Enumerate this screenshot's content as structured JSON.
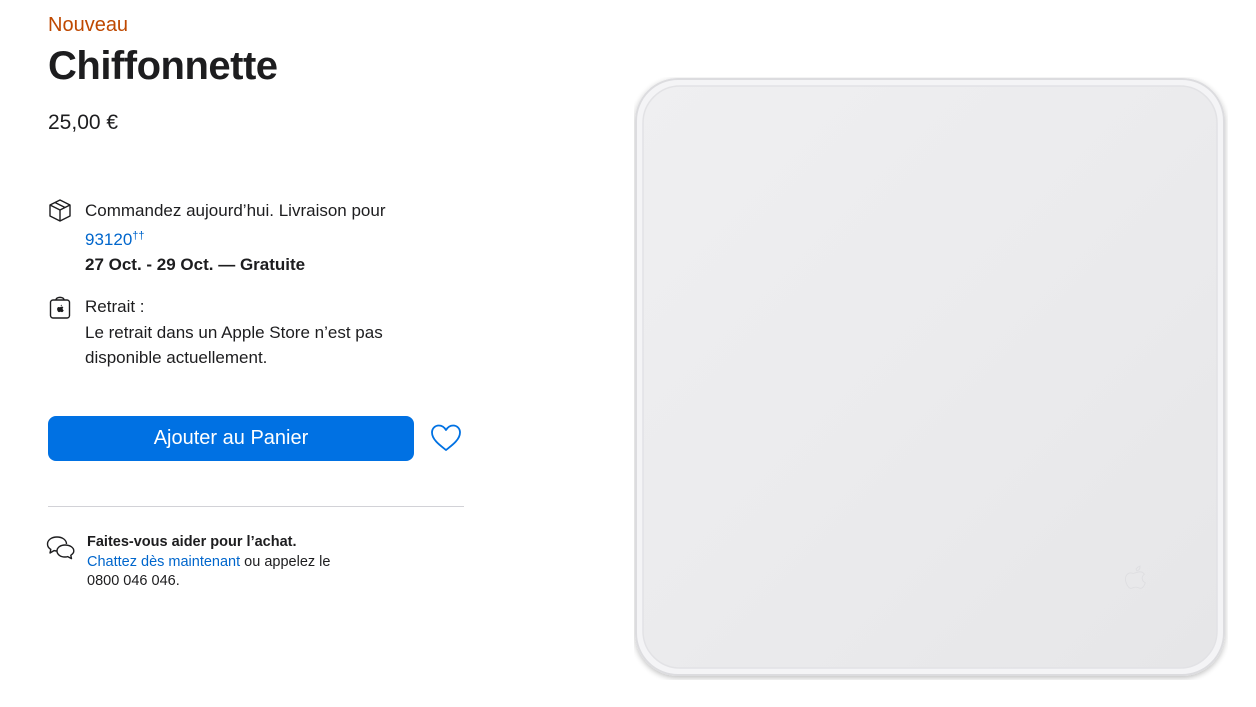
{
  "product": {
    "badge": "Nouveau",
    "name": "Chiffonnette",
    "price": "25,00 €"
  },
  "delivery": {
    "icon": "package-icon",
    "line1": "Commandez aujourd’hui. Livraison pour",
    "zip": "93120",
    "zip_marker": "††",
    "dates": "27 Oct. - 29 Oct. — Gratuite"
  },
  "pickup": {
    "icon": "apple-store-bag-icon",
    "label": "Retrait :",
    "line1": "Le retrait dans un Apple Store n’est pas",
    "line2": "disponible actuellement."
  },
  "actions": {
    "add_to_bag": "Ajouter au Panier",
    "favorite_icon": "heart-icon"
  },
  "help": {
    "icon": "chat-bubbles-icon",
    "title": "Faites-vous aider pour l’achat.",
    "chat_link": "Chattez dès maintenant",
    "or_call": " ou appelez le",
    "phone": "0800 046 046."
  },
  "colors": {
    "badge": "#bf4800",
    "link": "#0066cc",
    "button": "#0071e3",
    "text": "#1d1d1f",
    "divider": "#d2d2d7"
  }
}
